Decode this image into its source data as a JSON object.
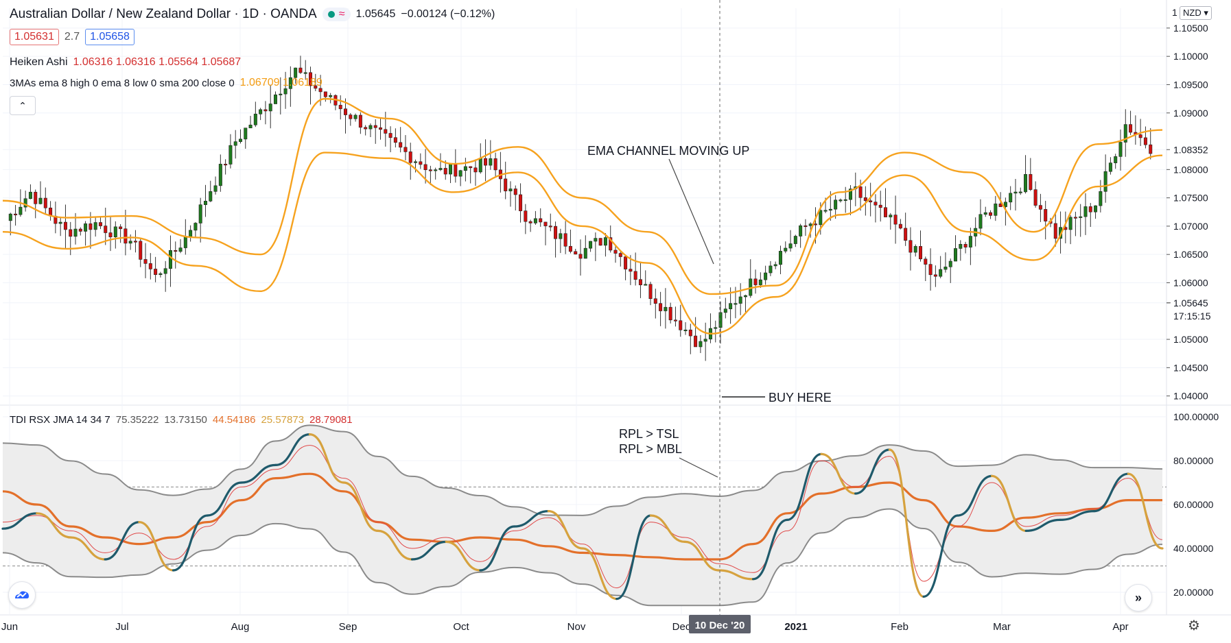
{
  "header": {
    "symbol_title": "Australian Dollar / New Zealand Dollar · 1D · OANDA",
    "last_price": "1.05645",
    "change": "−0.00124 (−0.12%)",
    "bid": "1.05631",
    "spread": "2.7",
    "ask": "1.05658",
    "currency": "NZD",
    "pill_icon": "≈"
  },
  "legends": {
    "heiken_name": "Heiken Ashi",
    "heiken_values": "1.06316  1.06316  1.05564  1.05687",
    "mas_name": "3MAs ema 8 high 0 ema 8 low 0 sma 200 close 0",
    "mas_values": "1.06709  1.06189",
    "tdi_name": "TDI RSX JMA 14 34 7",
    "tdi_v1": "75.35222",
    "tdi_v2": "13.73150",
    "tdi_v3": "44.54186",
    "tdi_v4": "25.57873",
    "tdi_v5": "28.79081"
  },
  "annotations": {
    "ema": "EMA CHANNEL MOVING UP",
    "buy": "BUY HERE",
    "rpl_tsl": "RPL > TSL",
    "rpl_mbl": "RPL > MBL"
  },
  "price_axis": {
    "ticks": [
      "1.10500",
      "1.10000",
      "1.09500",
      "1.09000",
      "1.08352",
      "1.08000",
      "1.07500",
      "1.07000",
      "1.06500",
      "1.06000",
      "1.05645",
      "1.05000",
      "1.04500",
      "1.04000"
    ],
    "top_label": "1",
    "countdown": "17:15:15"
  },
  "osc_axis": {
    "ticks": [
      "100.00000",
      "80.00000",
      "60.00000",
      "40.00000",
      "20.00000"
    ]
  },
  "time_axis": {
    "labels": [
      "Jun",
      "Jul",
      "Aug",
      "Sep",
      "Oct",
      "Nov",
      "Dec",
      "2021",
      "Feb",
      "Mar",
      "Apr"
    ],
    "crosshair_date": "10 Dec '20"
  },
  "colors": {
    "bull": "#1e7b1e",
    "bear": "#d01010",
    "ema": "#f6a21e",
    "rpl": "#1f5a6b",
    "rpl_down": "#d6a23e",
    "mbl": "#e3702a",
    "tsl": "#e04848",
    "band": "#8a8a8a"
  },
  "chart_data": [
    {
      "type": "candlestick",
      "title": "Australian Dollar / New Zealand Dollar · 1D · OANDA",
      "ylim": [
        1.0385,
        1.1085
      ],
      "note_series": "Heiken Ashi candles with EMA 8 high / EMA 8 low channel",
      "x": [
        "Jun",
        "Jul",
        "Aug",
        "Sep",
        "Oct",
        "Nov",
        "Dec",
        "2021",
        "Feb",
        "Mar",
        "Apr"
      ],
      "ema_high": [
        1.0745,
        1.0715,
        1.0718,
        1.068,
        1.065,
        1.0925,
        1.089,
        1.081,
        1.084,
        1.075,
        1.069,
        1.058,
        1.0595,
        1.076,
        1.083,
        1.0795,
        1.069,
        1.0845,
        1.087
      ],
      "ema_low": [
        1.069,
        1.066,
        1.068,
        1.063,
        1.0585,
        1.083,
        1.082,
        1.076,
        1.0795,
        1.07,
        1.0635,
        1.051,
        1.0575,
        1.072,
        1.079,
        1.069,
        1.064,
        1.077,
        1.0825
      ]
    },
    {
      "type": "line",
      "title": "TDI RSX JMA 14 34 7",
      "ylim": [
        10,
        105
      ],
      "levels": [
        68,
        32
      ],
      "series": [
        {
          "name": "RPL",
          "values": [
            49,
            56,
            45,
            35,
            52,
            30,
            55,
            70,
            78,
            92,
            70,
            48,
            35,
            43,
            30,
            50,
            57,
            40,
            17,
            55,
            43,
            30,
            26,
            53,
            83,
            65,
            85,
            18,
            55,
            73,
            48,
            53,
            57,
            74,
            40
          ]
        },
        {
          "name": "TSL",
          "values": [
            52,
            55,
            48,
            38,
            47,
            35,
            50,
            68,
            76,
            87,
            72,
            52,
            40,
            45,
            34,
            48,
            54,
            42,
            22,
            52,
            45,
            33,
            29,
            48,
            80,
            68,
            82,
            25,
            50,
            70,
            50,
            55,
            58,
            72,
            44
          ]
        },
        {
          "name": "MBL",
          "values": [
            66,
            60,
            50,
            45,
            42,
            45,
            52,
            62,
            72,
            74,
            66,
            52,
            44,
            43,
            45,
            44,
            41,
            38,
            37,
            36,
            35,
            35,
            42,
            56,
            65,
            68,
            70,
            62,
            50,
            48,
            54,
            56,
            58,
            62,
            62
          ]
        }
      ]
    }
  ]
}
